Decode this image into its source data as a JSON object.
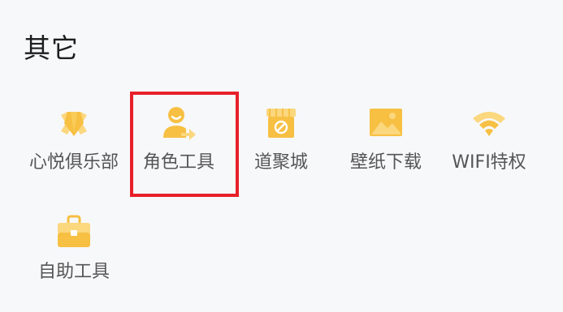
{
  "section": {
    "title": "其它"
  },
  "colors": {
    "background": "#f7f8fa",
    "icon_primary": "#f7c043",
    "icon_light": "#fbd77e",
    "label": "#555555",
    "title": "#1e1e1e",
    "highlight": "#e8202a"
  },
  "items": [
    {
      "label": "心悦俱乐部",
      "icon": "diamond-ribbon-icon"
    },
    {
      "label": "角色工具",
      "icon": "user-share-icon"
    },
    {
      "label": "道聚城",
      "icon": "store-icon"
    },
    {
      "label": "壁纸下载",
      "icon": "image-icon"
    },
    {
      "label": "WIFI特权",
      "icon": "wifi-icon"
    },
    {
      "label": "自助工具",
      "icon": "toolbox-icon"
    }
  ]
}
